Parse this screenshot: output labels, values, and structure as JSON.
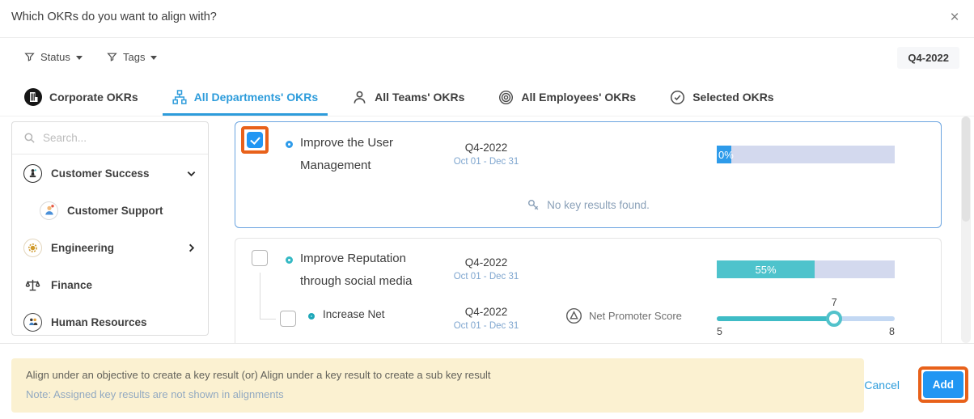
{
  "modal": {
    "title": "Which OKRs do you want to align with?",
    "close_glyph": "×"
  },
  "toolbar": {
    "status_filter": {
      "label": "Status"
    },
    "tags_filter": {
      "label": "Tags"
    },
    "period_badge": "Q4-2022"
  },
  "tabs": [
    {
      "label": "Corporate OKRs",
      "icon": "building",
      "active": false
    },
    {
      "label": "All Departments' OKRs",
      "icon": "org-chart",
      "active": true
    },
    {
      "label": "All Teams' OKRs",
      "icon": "person",
      "active": false
    },
    {
      "label": "All Employees' OKRs",
      "icon": "target",
      "active": false
    },
    {
      "label": "Selected OKRs",
      "icon": "check-circle",
      "active": false
    }
  ],
  "sidebar": {
    "search_placeholder": "Search...",
    "items": [
      {
        "label": "Customer Success",
        "expanded": true
      },
      {
        "label": "Customer Support",
        "child": true
      },
      {
        "label": "Engineering",
        "collapsed": true
      },
      {
        "label": "Finance"
      },
      {
        "label": "Human Resources"
      }
    ]
  },
  "okrs": [
    {
      "title": "Improve the User Management",
      "period": "Q4-2022",
      "date_range": "Oct 01 - Dec 31",
      "checked": true,
      "progress_label": "0%",
      "progress_width": "8%",
      "empty_message": "No key results found."
    },
    {
      "title": "Improve Reputation through social media",
      "period": "Q4-2022",
      "date_range": "Oct 01 - Dec 31",
      "checked": false,
      "progress_label": "55%",
      "progress_width": "55%",
      "key_result": {
        "title": "Increase Net",
        "period": "Q4-2022",
        "date_range": "Oct 01 - Dec 31",
        "metric": "Net Promoter Score",
        "slider": {
          "value": "7",
          "min": "5",
          "max": "8",
          "position": "66%"
        }
      }
    }
  ],
  "footer": {
    "note_line1": "Align under an objective to create a key result (or) Align under a key result to create a sub key result",
    "note_line2": "Note: Assigned key results are not shown in alignments",
    "cancel_label": "Cancel",
    "add_label": "Add"
  },
  "colors": {
    "accent_blue": "#2196f3",
    "tab_active_blue": "#2d9cdb",
    "progress_blue": "#2e9bea",
    "teal": "#4ec3cc",
    "progress_track": "#d3d9ee",
    "highlight_orange": "#e8611a",
    "banner_bg": "#fbf1d1",
    "selected_card_border": "#6ba4e0"
  }
}
